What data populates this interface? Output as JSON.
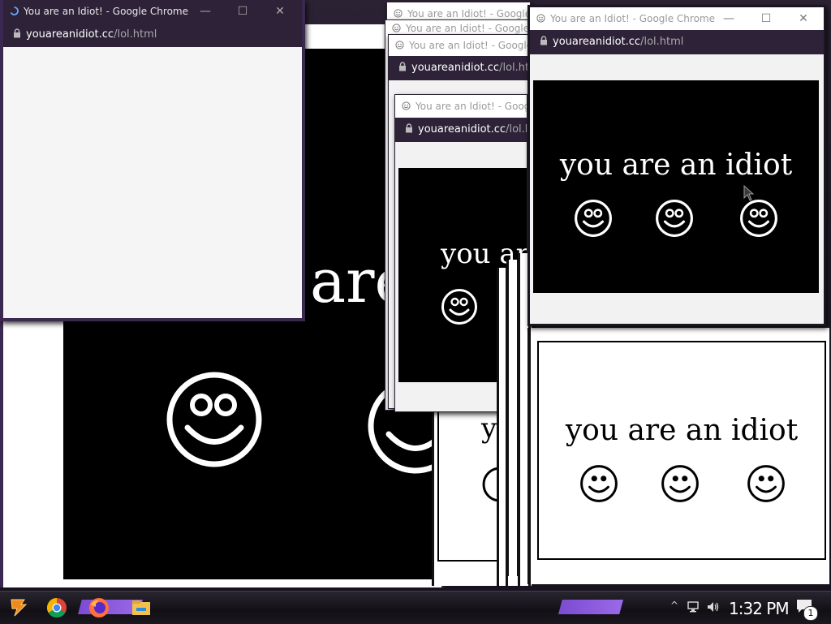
{
  "window_title": "You are an Idiot! - Google Chrome",
  "address": {
    "host": "youareanidiot.cc",
    "path": "/lol.html"
  },
  "page_text": "you are an idiot",
  "big_page_text": "are",
  "partial_texts": {
    "mid_black": "you ar",
    "mid_white": "y"
  },
  "window_buttons": {
    "minimize": "—",
    "maximize": "☐",
    "close": "✕"
  },
  "taskbar": {
    "pinned": [
      "start-menu",
      "chrome",
      "firefox",
      "file-explorer"
    ],
    "tray": {
      "network": "network-icon",
      "volume": "volume-icon",
      "notification_count": "1"
    },
    "time": "1:32 PM"
  },
  "colors": {
    "accent": "#8a5ad8",
    "titlebar_dark": "#2d2238"
  }
}
